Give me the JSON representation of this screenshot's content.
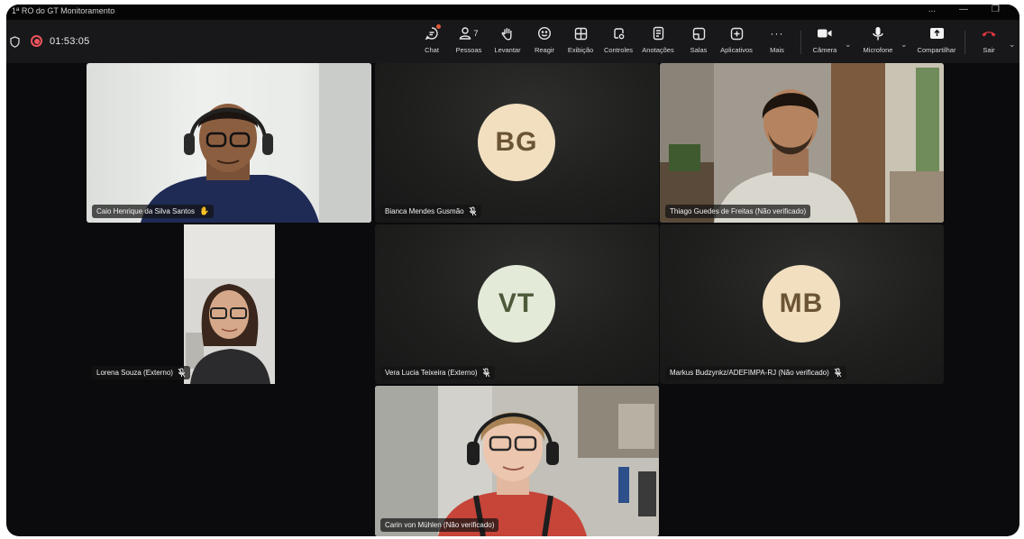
{
  "window": {
    "title": "1ª RO do GT Monitoramento",
    "controls": [
      "...",
      "—",
      "❐"
    ]
  },
  "toolbar": {
    "timer": "01:53:05",
    "buttons": [
      {
        "label": "Chat",
        "icon": "chat-icon"
      },
      {
        "label": "Pessoas",
        "icon": "people-icon",
        "count": "7"
      },
      {
        "label": "Levantar",
        "icon": "raise-hand-icon"
      },
      {
        "label": "Reagir",
        "icon": "smile-icon"
      },
      {
        "label": "Exibição",
        "icon": "grid-icon"
      },
      {
        "label": "Controles",
        "icon": "controls-icon"
      },
      {
        "label": "Anotações",
        "icon": "notes-icon"
      },
      {
        "label": "Salas",
        "icon": "rooms-icon"
      },
      {
        "label": "Aplicativos",
        "icon": "apps-icon"
      },
      {
        "label": "Mais",
        "icon": "more-icon"
      },
      {
        "label": "Câmera",
        "icon": "camera-icon"
      },
      {
        "label": "Microfone",
        "icon": "mic-icon"
      },
      {
        "label": "Compartilhar",
        "icon": "share-icon"
      },
      {
        "label": "Sair",
        "icon": "hangup-icon"
      }
    ],
    "colors": {
      "leave": "#e0353f",
      "record": "#f0545c",
      "chat_badge": "#e05a3a"
    }
  },
  "participants": [
    {
      "name": "Caio Henrique da Silva Santos",
      "video": true,
      "status_icon": "raised-hand-icon"
    },
    {
      "name": "Bianca Mendes Gusmão",
      "initials": "BG",
      "avatar_color": "#f1dfc0",
      "text_color": "#6b5433",
      "muted": true
    },
    {
      "name": "Thiago Guedes de Freitas (Não verificado)",
      "video": true
    },
    {
      "name": "Lorena Souza (Externo)",
      "video": true,
      "muted": true
    },
    {
      "name": "Vera Lucia Teixeira (Externo)",
      "initials": "VT",
      "avatar_color": "#e4ead8",
      "text_color": "#4d5a3a",
      "muted": true
    },
    {
      "name": "Markus Budzynkz/ADEFIMPA-RJ (Não verificado)",
      "initials": "MB",
      "avatar_color": "#f1dfc0",
      "text_color": "#6b5433",
      "muted": true
    },
    {
      "name": "Carin von Mühlen (Não verificado)",
      "video": true
    }
  ]
}
